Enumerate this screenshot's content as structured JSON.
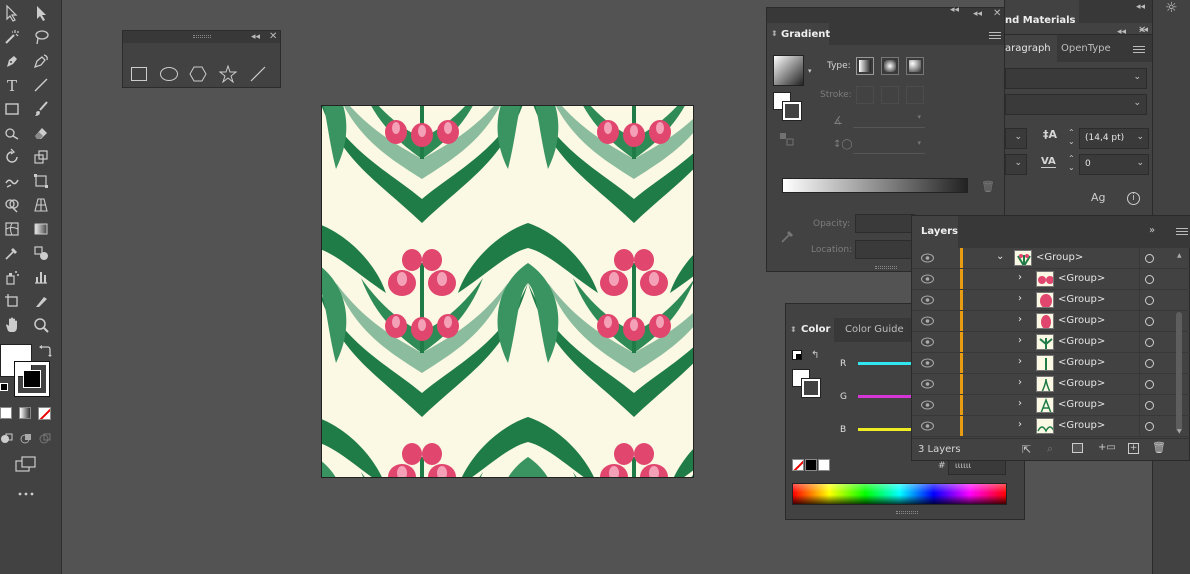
{
  "gradient": {
    "tab": "Gradient",
    "type_label": "Type:",
    "stroke_label": "Stroke:",
    "opacity_label": "Opacity:",
    "location_label": "Location:"
  },
  "properties": {
    "tab_materials": "nd Materials",
    "tab_paragraph": "aragraph",
    "tab_opentype": "OpenType",
    "leading_value": "(14,4 pt)",
    "tracking_value": "0"
  },
  "color": {
    "tab": "Color",
    "tab_guide": "Color Guide",
    "r_label": "R",
    "g_label": "G",
    "b_label": "B",
    "hex_label": "#",
    "hex_value": "ιιιιιι"
  },
  "layers": {
    "tab": "Layers",
    "count_label": "3 Layers",
    "rows": [
      {
        "label": "<Group>",
        "expanded": true
      },
      {
        "label": "<Group>"
      },
      {
        "label": "<Group>"
      },
      {
        "label": "<Group>"
      },
      {
        "label": "<Group>"
      },
      {
        "label": "<Group>"
      },
      {
        "label": "<Group>"
      },
      {
        "label": "<Group>"
      },
      {
        "label": "<Group>"
      }
    ]
  },
  "colors": {
    "ui_dark": "#424242",
    "canvas_bg": "#535353",
    "layer_accent": "#e79c12",
    "pattern_bg": "#fbf8e4",
    "leaf_green": "#1e7a45",
    "tulip_pink": "#e0466e",
    "r_slider": "#31e6f0",
    "g_slider": "#d536d8",
    "b_slider": "#eeec22"
  },
  "icons": [
    "selection-icon",
    "direct-selection-icon",
    "magic-wand-icon",
    "lasso-icon",
    "pen-icon",
    "curvature-icon",
    "type-icon",
    "line-icon",
    "rectangle-icon",
    "paintbrush-icon",
    "shaper-icon",
    "eraser-icon",
    "rotate-icon",
    "scale-icon",
    "warp-icon",
    "free-transform-icon",
    "shape-builder-icon",
    "perspective-grid-icon",
    "mesh-icon",
    "gradient-icon",
    "eyedropper-icon",
    "blend-icon",
    "symbol-sprayer-icon",
    "column-graph-icon",
    "artboard-icon",
    "slice-icon",
    "hand-icon",
    "zoom-icon"
  ]
}
